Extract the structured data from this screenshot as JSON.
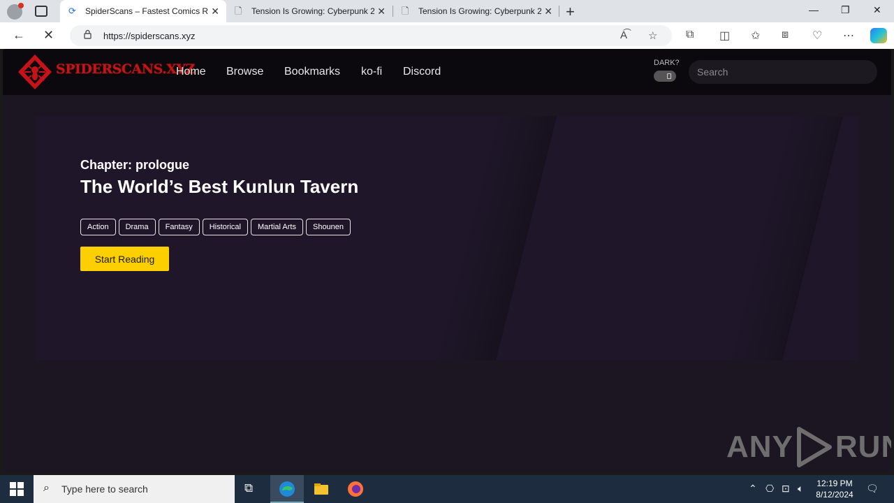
{
  "browser": {
    "tabs": [
      {
        "title": "SpiderScans – Fastest Comics Rel",
        "icon": "spider-favicon",
        "active": true
      },
      {
        "title": "Tension Is Growing: Cyberpunk 2",
        "icon": "document-icon",
        "active": false
      },
      {
        "title": "Tension Is Growing: Cyberpunk 2",
        "icon": "document-icon",
        "active": false
      }
    ],
    "url": "https://spiderscans.xyz"
  },
  "site": {
    "logo_text": "SPIDERSCANS.XYZ",
    "nav": [
      "Home",
      "Browse",
      "Bookmarks",
      "ko-fi",
      "Discord"
    ],
    "dark_label": "DARK?",
    "search_placeholder": "Search"
  },
  "hero": {
    "chapter": "Chapter: prologue",
    "title": "The World’s Best Kunlun Tavern",
    "genres": [
      "Action",
      "Drama",
      "Fantasy",
      "Historical",
      "Martial Arts",
      "Shounen"
    ],
    "cta": "Start Reading"
  },
  "watermark": {
    "left": "ANY",
    "right": "RUN"
  },
  "taskbar": {
    "search_placeholder": "Type here to search",
    "time": "12:19 PM",
    "date": "8/12/2024"
  },
  "colors": {
    "accent": "#fcd000",
    "page_bg": "#1b1622",
    "hero_bg": "#1f1729",
    "header_bg": "#0b090d",
    "logo_red": "#c8121a"
  }
}
